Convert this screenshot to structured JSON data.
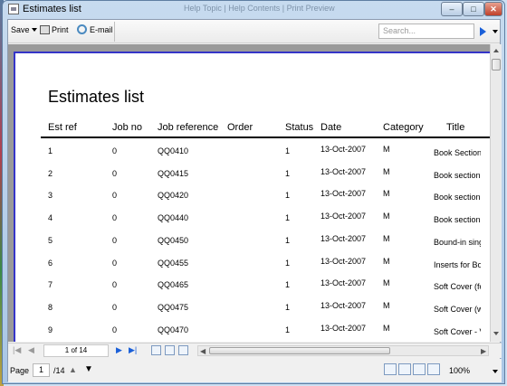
{
  "window": {
    "title": "Estimates list",
    "background_caption": "Help Topic | Help Contents | Print Preview"
  },
  "toolbar": {
    "save_label": "Save",
    "print_label": "Print",
    "email_label": "E-mail",
    "search_placeholder": "Search..."
  },
  "report": {
    "title": "Estimates list",
    "columns": [
      "Est ref",
      "Job no",
      "Job reference",
      "Order",
      "Status",
      "Date",
      "Category",
      "Title"
    ],
    "rows": [
      {
        "est_ref": "1",
        "job_no": "0",
        "job_reference": "QQ0410",
        "order": "",
        "status": "1",
        "date": "13-Oct-2007",
        "category": "M",
        "title": "Book Section (c"
      },
      {
        "est_ref": "2",
        "job_no": "0",
        "job_reference": "QQ0415",
        "order": "",
        "status": "1",
        "date": "13-Oct-2007",
        "category": "M",
        "title": "Book section +"
      },
      {
        "est_ref": "3",
        "job_no": "0",
        "job_reference": "QQ0420",
        "order": "",
        "status": "1",
        "date": "13-Oct-2007",
        "category": "M",
        "title": "Book section +"
      },
      {
        "est_ref": "4",
        "job_no": "0",
        "job_reference": "QQ0440",
        "order": "",
        "status": "1",
        "date": "13-Oct-2007",
        "category": "M",
        "title": "Book section +"
      },
      {
        "est_ref": "5",
        "job_no": "0",
        "job_reference": "QQ0450",
        "order": "",
        "status": "1",
        "date": "13-Oct-2007",
        "category": "M",
        "title": "Bound-in single"
      },
      {
        "est_ref": "6",
        "job_no": "0",
        "job_reference": "QQ0455",
        "order": "",
        "status": "1",
        "date": "13-Oct-2007",
        "category": "M",
        "title": "Inserts for Book"
      },
      {
        "est_ref": "7",
        "job_no": "0",
        "job_reference": "QQ0465",
        "order": "",
        "status": "1",
        "date": "13-Oct-2007",
        "category": "M",
        "title": "Soft Cover (for"
      },
      {
        "est_ref": "8",
        "job_no": "0",
        "job_reference": "QQ0475",
        "order": "",
        "status": "1",
        "date": "13-Oct-2007",
        "category": "M",
        "title": "Soft Cover (with"
      },
      {
        "est_ref": "9",
        "job_no": "0",
        "job_reference": "QQ0470",
        "order": "",
        "status": "1",
        "date": "13-Oct-2007",
        "category": "M",
        "title": "Soft Cover - Va"
      }
    ]
  },
  "navigation": {
    "page_of": "1 of 14"
  },
  "status": {
    "page_label": "Page",
    "page_value": "1",
    "total": "/14",
    "zoom": "100%"
  },
  "colors": {
    "accent": "#1a5fd8",
    "page_border": "#3535c8",
    "viewer_bg": "#9a9a9a"
  }
}
